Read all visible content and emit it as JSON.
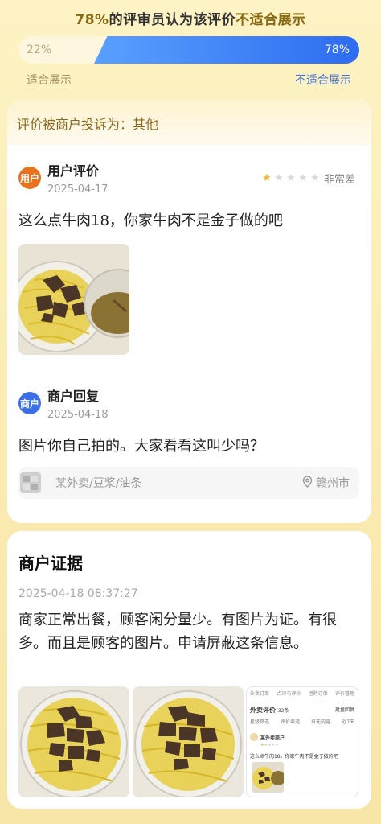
{
  "header": {
    "pct": "78%",
    "mid": "的评审员认为该评价",
    "verdict": "不适合展示"
  },
  "vote_bar": {
    "left_pct": "22%",
    "right_pct": "78%",
    "left_fraction": 0.22,
    "right_fraction": 0.78,
    "left_label": "适合展示",
    "right_label": "不适合展示",
    "colors": {
      "left": "#fdf7df",
      "right": "#2d6cf0"
    }
  },
  "complaint": {
    "text": "评价被商户投诉为：其他"
  },
  "review": {
    "avatar_label": "用户",
    "title": "用户评价",
    "date": "2025-04-17",
    "stars": 1,
    "max_stars": 5,
    "rating_text": "非常差",
    "text": "这么点牛肉18，你家牛肉不是金子做的吧"
  },
  "reply": {
    "avatar_label": "商户",
    "title": "商户回复",
    "date": "2025-04-18",
    "text": "图片你自己拍的。大家看看这叫少吗？"
  },
  "store": {
    "name": "某外卖/豆浆/油条",
    "location": "赣州市",
    "icon": "location-pin-icon"
  },
  "evidence": {
    "title": "商户证据",
    "datetime": "2025-04-18 08:37:27",
    "text": "商家正常出餐，顾客闲分量少。有图片为证。有很多。而且是顾客的图片。申请屏蔽这条信息。",
    "screenshot": {
      "tabs": [
        "外卖订单",
        "点评与评价",
        "团购订单",
        "评价管理"
      ],
      "header": "外卖评价",
      "count": "32条",
      "filter": "批量回复",
      "filters": [
        "星级筛选",
        "评价渠道",
        "有无内容",
        "近7天"
      ],
      "merchant": "某外卖商户",
      "text": "这么点牛肉18，你家牛肉不是金子做的吧"
    }
  }
}
